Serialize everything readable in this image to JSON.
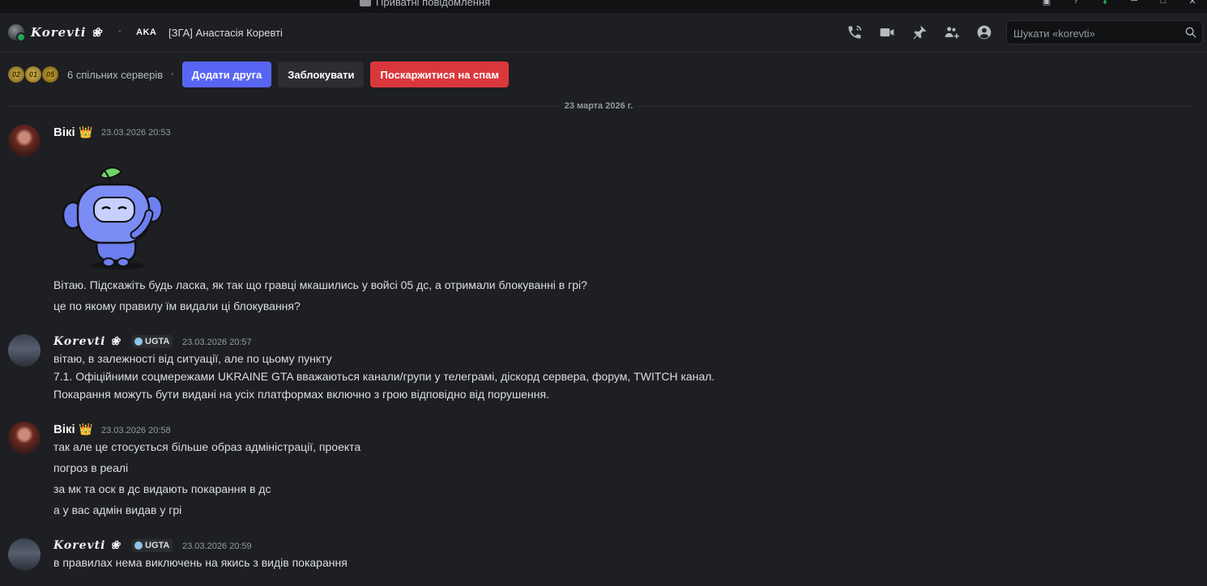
{
  "window": {
    "title": "Приватні повідомлення"
  },
  "header": {
    "display_name": "Korevti ❀",
    "guild_tag": "AKA",
    "guild_name": "[ЗГА] Анастасія Коревті",
    "icons": [
      "voice-call-icon",
      "video-call-icon",
      "pin-icon",
      "add-friends-to-dm-icon",
      "user-profile-icon"
    ],
    "search_placeholder": "Шукати «korevti»"
  },
  "profile_bar": {
    "servers": [
      "02",
      "01",
      "05"
    ],
    "mutual_servers": "6 спільних серверів",
    "add_friend": "Додати друга",
    "block": "Заблокувати",
    "report_spam": "Поскаржитися на спам"
  },
  "date_divider": "23 марта 2026 г.",
  "messages": [
    {
      "author": "Вікі",
      "badge": "👑",
      "timestamp": "23.03.2026 20:53",
      "lines": [
        "Вітаю. Підскажіть будь ласка, як так що гравці мкашились у войсі 05 дс, а отримали блокуванні в грі?",
        "це по якому правилу їм видали ці блокування?"
      ]
    },
    {
      "author": "Korevti ❀",
      "tag": "UGTA",
      "timestamp": "23.03.2026 20:57",
      "lines": [
        "вітаю, в залежності від ситуації, але по цьому пункту",
        "7.1. Офіційними соцмережами UKRAINE GTA вважаються канали/групи у телеграмі, діскорд сервера, форум, TWITCH канал.",
        "Покарання можуть бути видані на усіх платформах включно з грою відповідно від порушення."
      ]
    },
    {
      "author": "Вікі",
      "badge": "👑",
      "timestamp": "23.03.2026 20:58",
      "lines": [
        "так але це стосується більше образ адміністрації, проекта",
        "погроз в реалі",
        "за мк та оск в дс видають покарання в дс",
        "а у вас адмін видав у грі"
      ]
    },
    {
      "author": "Korevti ❀",
      "tag": "UGTA",
      "timestamp": "23.03.2026 20:59",
      "lines": [
        "в правилах нема виключень на якись з видів покарання"
      ]
    }
  ]
}
